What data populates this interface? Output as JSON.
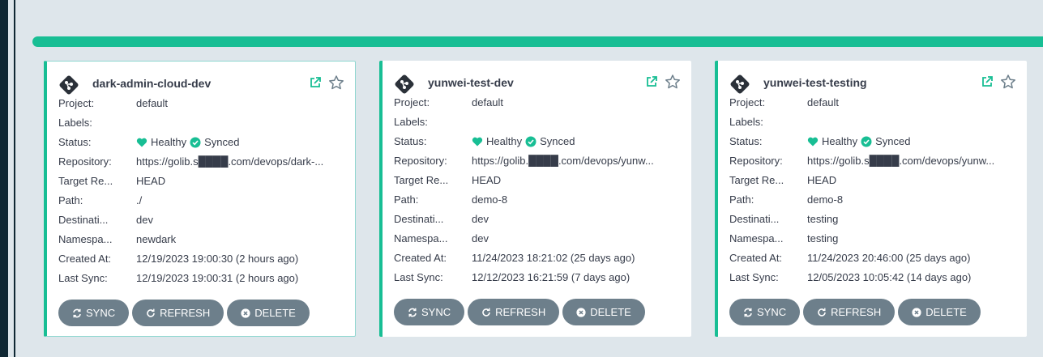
{
  "theme": {
    "accent": "#18be94",
    "button": "#6d7f8b",
    "text": "#363c4a"
  },
  "labels": {
    "project": "Project:",
    "labels": "Labels:",
    "status": "Status:",
    "repository": "Repository:",
    "target": "Target Re...",
    "path": "Path:",
    "destination": "Destinati...",
    "namespace": "Namespa...",
    "created": "Created At:",
    "last_sync": "Last Sync:"
  },
  "buttons": {
    "sync": "SYNC",
    "refresh": "REFRESH",
    "delete": "DELETE"
  },
  "icons": {
    "app": "git-diamond-icon",
    "external": "external-link-icon",
    "favorite": "star-icon",
    "health": "heart-icon",
    "synced": "check-circle-icon",
    "sync": "sync-icon",
    "refresh": "refresh-icon",
    "delete": "times-circle-icon"
  },
  "apps": [
    {
      "name": "dark-admin-cloud-dev",
      "project": "default",
      "labels": "",
      "health": "Healthy",
      "sync": "Synced",
      "repository": "https://golib.s████.com/devops/dark-...",
      "target_revision": "HEAD",
      "path": "./",
      "destination": "dev",
      "namespace": "newdark",
      "created_at": "12/19/2023 19:00:30  (2 hours ago)",
      "last_sync": "12/19/2023 19:00:31  (2 hours ago)"
    },
    {
      "name": "yunwei-test-dev",
      "project": "default",
      "labels": "",
      "health": "Healthy",
      "sync": "Synced",
      "repository": "https://golib.████.com/devops/yunw...",
      "target_revision": "HEAD",
      "path": "demo-8",
      "destination": "dev",
      "namespace": "dev",
      "created_at": "11/24/2023 18:21:02  (25 days ago)",
      "last_sync": "12/12/2023 16:21:59  (7 days ago)"
    },
    {
      "name": "yunwei-test-testing",
      "project": "default",
      "labels": "",
      "health": "Healthy",
      "sync": "Synced",
      "repository": "https://golib.s████.com/devops/yunw...",
      "target_revision": "HEAD",
      "path": "demo-8",
      "destination": "testing",
      "namespace": "testing",
      "created_at": "11/24/2023 20:46:00  (25 days ago)",
      "last_sync": "12/05/2023 10:05:42  (14 days ago)"
    }
  ]
}
